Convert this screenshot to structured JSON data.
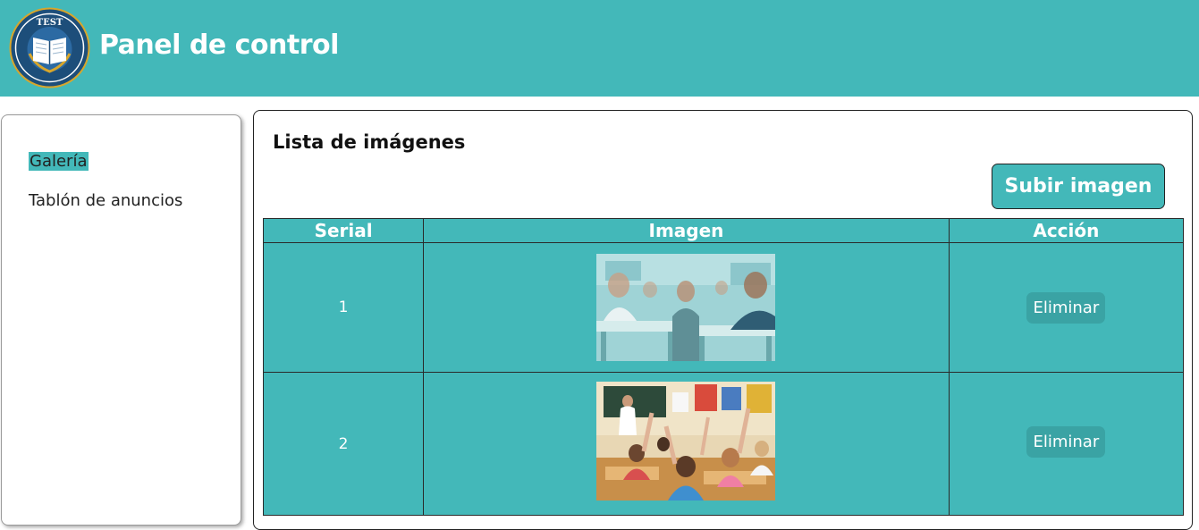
{
  "header": {
    "title": "Panel de control",
    "logo_text": "TEST"
  },
  "sidebar": {
    "items": [
      {
        "label": "Galería",
        "active": true
      },
      {
        "label": "Tablón de anuncios",
        "active": false
      }
    ]
  },
  "main": {
    "title": "Lista de imágenes",
    "upload_label": "Subir imagen",
    "table": {
      "headers": [
        "Serial",
        "Imagen",
        "Acción"
      ],
      "rows": [
        {
          "serial": "1",
          "image": "classroom-students-photo",
          "action": "Eliminar"
        },
        {
          "serial": "2",
          "image": "classroom-hands-raised-photo",
          "action": "Eliminar"
        }
      ]
    }
  },
  "colors": {
    "accent": "#43b8b9",
    "delete_button": "#3aa3a4",
    "logo_navy": "#1d4e7a",
    "logo_gold": "#d8a62b"
  }
}
